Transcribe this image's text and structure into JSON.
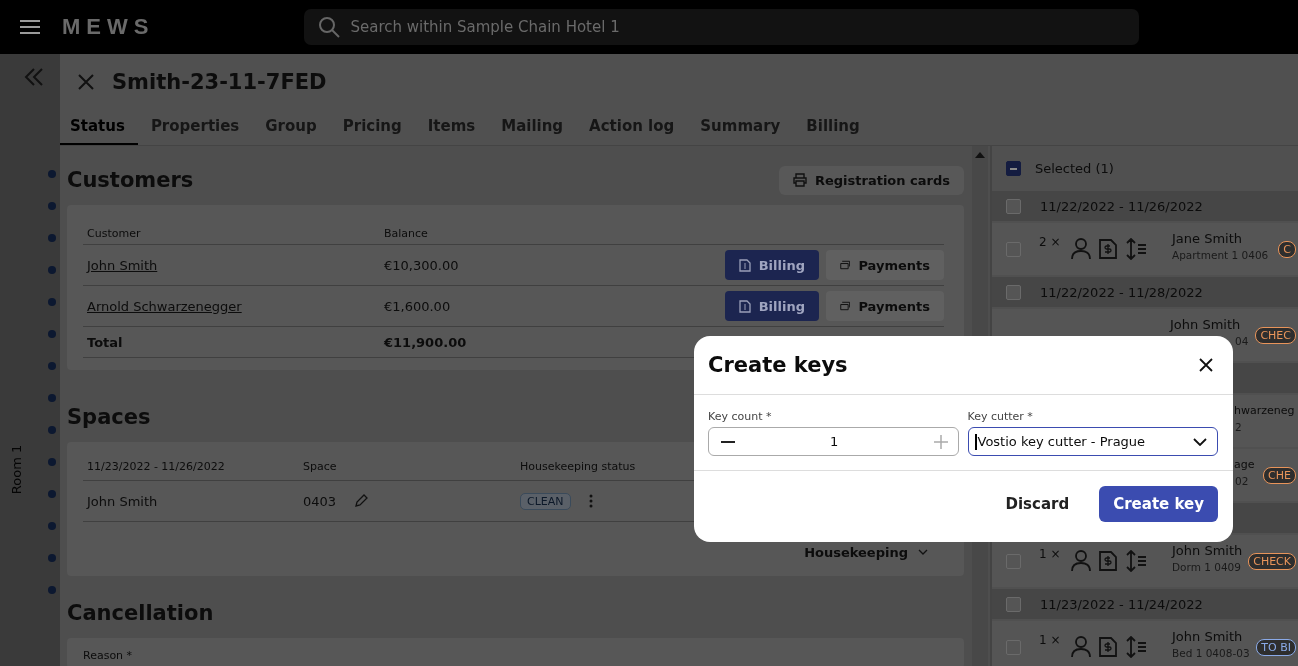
{
  "top_bar": {
    "logo": "MEWS",
    "search": {
      "placeholder": "Search within Sample Chain Hotel 1"
    }
  },
  "timeline": {
    "label": "Room 1"
  },
  "reservation": {
    "title": "Smith-23-11-7FED"
  },
  "tabs": [
    {
      "label": "Status",
      "selected": true
    },
    {
      "label": "Properties",
      "selected": false
    },
    {
      "label": "Group",
      "selected": false
    },
    {
      "label": "Pricing",
      "selected": false
    },
    {
      "label": "Items",
      "selected": false
    },
    {
      "label": "Mailing",
      "selected": false
    },
    {
      "label": "Action log",
      "selected": false
    },
    {
      "label": "Summary",
      "selected": false
    },
    {
      "label": "Billing",
      "selected": false
    }
  ],
  "customers": {
    "heading": "Customers",
    "registration_button": "Registration cards",
    "columns": [
      "Customer",
      "Balance"
    ],
    "rows": [
      {
        "name": "John Smith",
        "balance": "€10,300.00",
        "billing": "Billing",
        "payments": "Payments"
      },
      {
        "name": "Arnold Schwarzenegger",
        "balance": "€1,600.00",
        "billing": "Billing",
        "payments": "Payments"
      }
    ],
    "total": {
      "label": "Total",
      "balance": "€11,900.00"
    }
  },
  "spaces": {
    "heading": "Spaces",
    "columns": [
      "11/23/2022 - 11/26/2022",
      "Space",
      "Housekeeping status"
    ],
    "rows": [
      {
        "customer": "John Smith",
        "space": "0403",
        "status": "CLEAN"
      }
    ],
    "housekeeping_button": "Housekeeping"
  },
  "cancellation": {
    "heading": "Cancellation",
    "reason_label": "Reason *"
  },
  "side_list": {
    "header": {
      "label": "Selected (1)",
      "indeterminate": true
    },
    "items": [
      {
        "kind": "group",
        "date": "11/22/2022 - 11/26/2022",
        "checked": false
      },
      {
        "kind": "item",
        "checked": false,
        "count": "2 ×",
        "name": "Jane Smith",
        "subtitle": "Apartment 1 0406",
        "badge": "C",
        "color": "#e8945a"
      },
      {
        "kind": "group",
        "date": "11/22/2022 - 11/28/2022",
        "checked": false
      },
      {
        "kind": "partial",
        "name": "John Smith",
        "subtitle_tail": "04",
        "badge": "CHEC",
        "color": "#e8945a"
      },
      {
        "kind": "hidden_group"
      },
      {
        "kind": "partial",
        "name_tail": "hwarzeneg",
        "subtitle_tail": "2"
      },
      {
        "kind": "partial",
        "name_tail": "age",
        "subtitle_tail": "02",
        "badge": "CHE",
        "color": "#e8945a"
      },
      {
        "kind": "hidden_group"
      },
      {
        "kind": "item",
        "checked": false,
        "count": "1 ×",
        "name": "John Smith",
        "subtitle": "Dorm 1 0409",
        "badge": "CHECK",
        "color": "#e8945a"
      },
      {
        "kind": "group",
        "date": "11/23/2022 - 11/24/2022",
        "checked": false
      },
      {
        "kind": "item",
        "checked": false,
        "count": "1 ×",
        "name": "John Smith",
        "subtitle": "Bed 1 0408-03",
        "badge": "TO BI",
        "color": "#8aaae8"
      }
    ]
  },
  "dialog": {
    "title": "Create keys",
    "key_count": {
      "label": "Key count *",
      "value": "1"
    },
    "key_cutter": {
      "label": "Key cutter *",
      "value": "Vostio key cutter - Prague"
    },
    "discard": "Discard",
    "confirm": "Create key"
  }
}
